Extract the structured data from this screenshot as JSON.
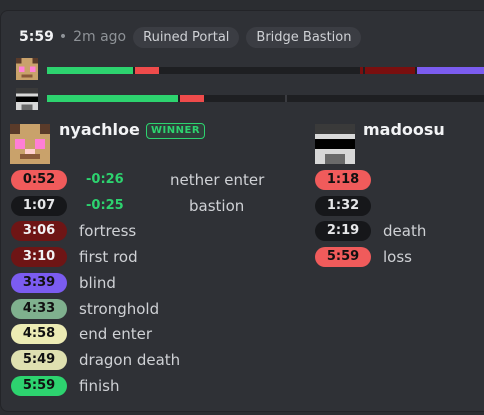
{
  "header": {
    "time": "5:59",
    "separator": "•",
    "ago": "2m ago",
    "tags": [
      "Ruined Portal",
      "Bridge Bastion"
    ]
  },
  "progress": {
    "player1": {
      "segments": [
        {
          "color": "#2dd36f",
          "fraction": 0.147
        },
        {
          "color": "#ef4b4b",
          "fraction": 0.045
        },
        {
          "color": "#1e1f22",
          "fraction": 0.0
        },
        {
          "color": "#7a0f0f",
          "fraction": 0.14
        },
        {
          "color": "#7b5cf0",
          "fraction": 0.16
        }
      ]
    },
    "player2": {
      "segments": [
        {
          "color": "#2dd36f",
          "fraction": 0.23
        },
        {
          "color": "#ef4b4b",
          "fraction": 0.04
        }
      ]
    }
  },
  "players": [
    {
      "name": "nyachloe",
      "badge": "WINNER",
      "avatar": "cat-skin-avatar",
      "splits": [
        {
          "time": "0:52",
          "diff": "-0:26",
          "event": "nether enter",
          "bg": "#f05b5b",
          "fg": "#111"
        },
        {
          "time": "1:07",
          "diff": "-0:25",
          "event": "bastion",
          "bg": "#16171a",
          "fg": "#e6e7e9"
        },
        {
          "time": "3:06",
          "diff": "",
          "event": "fortress",
          "bg": "#6e1515",
          "fg": "#f2f3f5"
        },
        {
          "time": "3:10",
          "diff": "",
          "event": "first rod",
          "bg": "#6e1515",
          "fg": "#f2f3f5"
        },
        {
          "time": "3:39",
          "diff": "",
          "event": "blind",
          "bg": "#7b5cf0",
          "fg": "#111"
        },
        {
          "time": "4:33",
          "diff": "",
          "event": "stronghold",
          "bg": "#7fb08e",
          "fg": "#111"
        },
        {
          "time": "4:58",
          "diff": "",
          "event": "end enter",
          "bg": "#ecebb4",
          "fg": "#111"
        },
        {
          "time": "5:49",
          "diff": "",
          "event": "dragon death",
          "bg": "#dfe0b0",
          "fg": "#111"
        },
        {
          "time": "5:59",
          "diff": "",
          "event": "finish",
          "bg": "#2dd36f",
          "fg": "#111"
        }
      ]
    },
    {
      "name": "madoosu",
      "avatar": "sunglasses-skin-avatar",
      "splits": [
        {
          "time": "1:18",
          "event": "",
          "bg": "#f05b5b",
          "fg": "#111"
        },
        {
          "time": "1:32",
          "event": "",
          "bg": "#16171a",
          "fg": "#e6e7e9"
        },
        {
          "time": "2:19",
          "event": "death",
          "bg": "#16171a",
          "fg": "#e6e7e9"
        },
        {
          "time": "5:59",
          "event": "loss",
          "bg": "#f05b5b",
          "fg": "#111"
        }
      ]
    }
  ]
}
